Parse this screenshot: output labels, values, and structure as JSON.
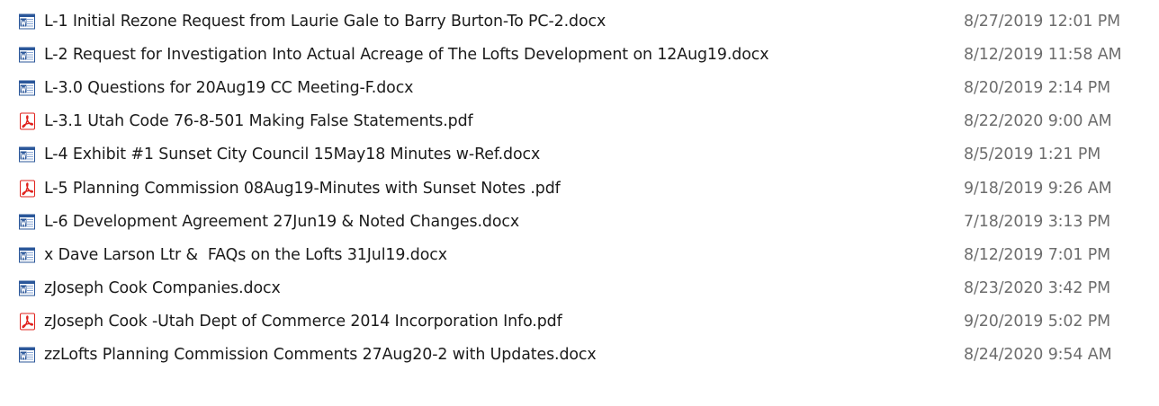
{
  "files": [
    {
      "name": "L-1 Initial Rezone Request from Laurie Gale to Barry Burton-To PC-2.docx",
      "date_modified": "8/27/2019 12:01 PM",
      "type_icon": "word-doc-icon"
    },
    {
      "name": "L-2 Request for Investigation Into Actual Acreage of The Lofts Development on 12Aug19.docx",
      "date_modified": "8/12/2019 11:58 AM",
      "type_icon": "word-doc-icon"
    },
    {
      "name": "L-3.0 Questions for 20Aug19 CC Meeting-F.docx",
      "date_modified": "8/20/2019 2:14 PM",
      "type_icon": "word-doc-icon"
    },
    {
      "name": "L-3.1 Utah Code 76-8-501 Making False Statements.pdf",
      "date_modified": "8/22/2020 9:00 AM",
      "type_icon": "pdf-icon"
    },
    {
      "name": "L-4 Exhibit #1 Sunset City Council 15May18 Minutes w-Ref.docx",
      "date_modified": "8/5/2019 1:21 PM",
      "type_icon": "word-doc-icon"
    },
    {
      "name": "L-5 Planning Commission 08Aug19-Minutes with Sunset Notes .pdf",
      "date_modified": "9/18/2019 9:26 AM",
      "type_icon": "pdf-icon"
    },
    {
      "name": "L-6 Development Agreement 27Jun19 & Noted Changes.docx",
      "date_modified": "7/18/2019 3:13 PM",
      "type_icon": "word-doc-icon"
    },
    {
      "name": "x Dave Larson Ltr &  FAQs on the Lofts 31Jul19.docx",
      "date_modified": "8/12/2019 7:01 PM",
      "type_icon": "word-doc-icon"
    },
    {
      "name": "zJoseph Cook Companies.docx",
      "date_modified": "8/23/2020 3:42 PM",
      "type_icon": "word-doc-icon"
    },
    {
      "name": "zJoseph Cook -Utah Dept of Commerce 2014 Incorporation Info.pdf",
      "date_modified": "9/20/2019 5:02 PM",
      "type_icon": "pdf-icon"
    },
    {
      "name": "zzLofts Planning Commission Comments 27Aug20-2 with Updates.docx",
      "date_modified": "8/24/2020 9:54 AM",
      "type_icon": "word-doc-icon"
    }
  ],
  "colors": {
    "name_text": "#1b1b1b",
    "date_text": "#6d6d6d",
    "word_icon_blue": "#2b579a",
    "pdf_icon_red": "#e0201b"
  }
}
